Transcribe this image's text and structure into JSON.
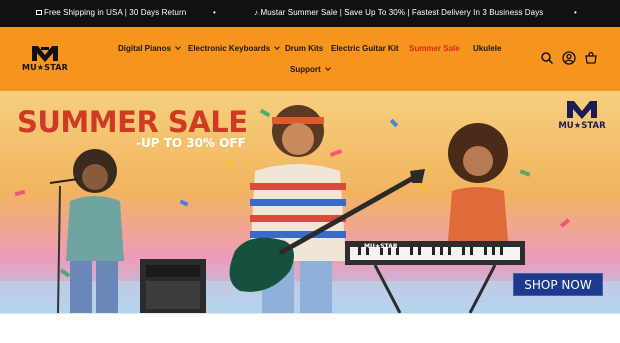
{
  "announcement": {
    "items": [
      {
        "icon": "truck-icon",
        "text": "Free Shipping in USA | 30 Days Return"
      },
      {
        "icon": "music-note-icon",
        "text": "Mustar Summer Sale | Save Up To 30% | Fastest Delivery In 3 Business Days"
      }
    ]
  },
  "header": {
    "logo_text": "MU★STAR",
    "nav": [
      {
        "label": "Digital Pianos",
        "dropdown": true
      },
      {
        "label": "Electronic Keyboards",
        "dropdown": true
      },
      {
        "label": "Drum Kits",
        "dropdown": false
      },
      {
        "label": "Electric Guitar Kit",
        "dropdown": false
      },
      {
        "label": "Summer Sale",
        "dropdown": false,
        "highlight": "#d9261c"
      },
      {
        "label": "Ukulele",
        "dropdown": false
      },
      {
        "label": "Support",
        "dropdown": true
      }
    ],
    "icons": [
      "search-icon",
      "account-icon",
      "cart-icon"
    ],
    "background": "#f7941d"
  },
  "hero": {
    "title": "SUMMER SALE",
    "subtitle": "-UP TO 30% OFF",
    "logo_text": "MU★STAR",
    "keyboard_brand": "MU★STAR",
    "cta": "SHOP NOW",
    "title_color": "#cf3a26",
    "cta_color": "#1d3a8c"
  }
}
